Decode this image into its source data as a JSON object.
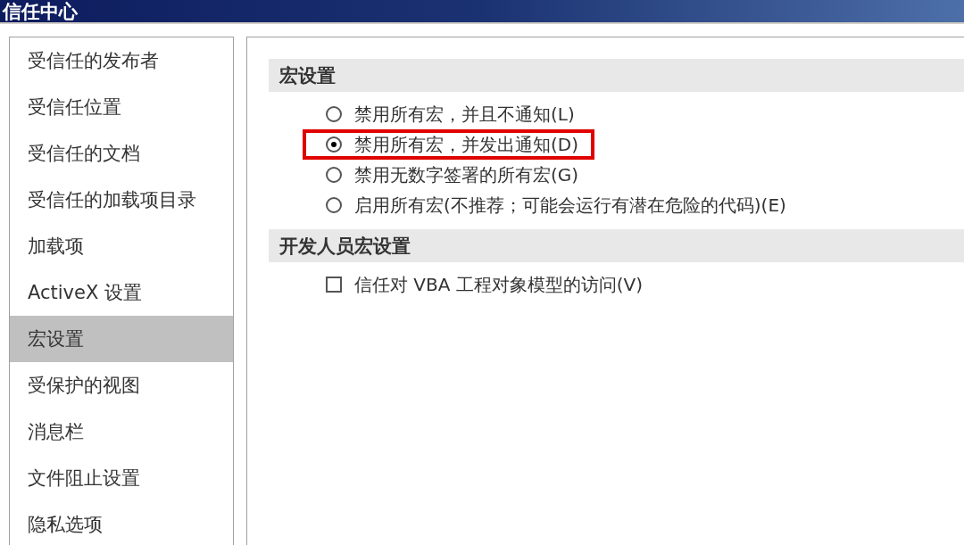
{
  "window": {
    "title": "信任中心"
  },
  "sidebar": {
    "items": [
      {
        "label": "受信任的发布者",
        "selected": false
      },
      {
        "label": "受信任位置",
        "selected": false
      },
      {
        "label": "受信任的文档",
        "selected": false
      },
      {
        "label": "受信任的加载项目录",
        "selected": false
      },
      {
        "label": "加载项",
        "selected": false
      },
      {
        "label": "ActiveX 设置",
        "selected": false
      },
      {
        "label": "宏设置",
        "selected": true
      },
      {
        "label": "受保护的视图",
        "selected": false
      },
      {
        "label": "消息栏",
        "selected": false
      },
      {
        "label": "文件阻止设置",
        "selected": false
      },
      {
        "label": "隐私选项",
        "selected": false
      }
    ]
  },
  "sections": [
    {
      "heading": "宏设置",
      "kind": "radio",
      "options": [
        {
          "label": "禁用所有宏，并且不通知(L)",
          "selected": false,
          "highlighted": false
        },
        {
          "label": "禁用所有宏，并发出通知(D)",
          "selected": true,
          "highlighted": true
        },
        {
          "label": "禁用无数字签署的所有宏(G)",
          "selected": false,
          "highlighted": false
        },
        {
          "label": "启用所有宏(不推荐；可能会运行有潜在危险的代码)(E)",
          "selected": false,
          "highlighted": false
        }
      ]
    },
    {
      "heading": "开发人员宏设置",
      "kind": "checkbox",
      "options": [
        {
          "label": "信任对 VBA 工程对象模型的访问(V)",
          "checked": false
        }
      ]
    }
  ]
}
